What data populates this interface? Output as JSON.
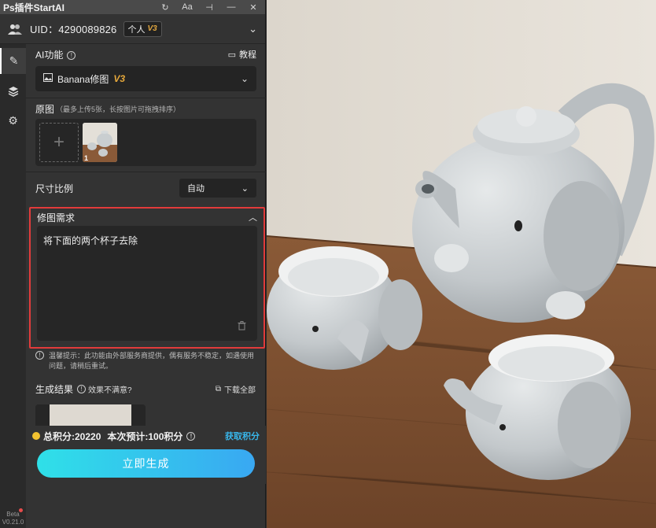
{
  "app": {
    "title": "Ps插件StartAI"
  },
  "window_controls": [
    {
      "name": "refresh-icon",
      "glyph": "↻"
    },
    {
      "name": "font-size-icon",
      "glyph": "Aa"
    },
    {
      "name": "pin-icon",
      "glyph": "⊣"
    },
    {
      "name": "minimize-icon",
      "glyph": "—"
    },
    {
      "name": "close-icon",
      "glyph": "✕"
    }
  ],
  "account": {
    "uid": "UID：4290089826",
    "plan": "个人",
    "level": "V3"
  },
  "rail": {
    "items": [
      "edit-icon",
      "layers-icon",
      "settings-icon"
    ],
    "version_top": "Beta",
    "version": "V0.21.0"
  },
  "ai_function": {
    "label": "AI功能",
    "tutorial": "教程",
    "selected": "Banana修图",
    "selected_badge": "V3"
  },
  "source_images": {
    "label": "原图",
    "hint": "（最多上传5张，长按图片可拖拽排序）",
    "add": "+",
    "thumb_index": "1"
  },
  "ratio": {
    "label": "尺寸比例",
    "value": "自动"
  },
  "request": {
    "label": "修图需求",
    "text": "将下面的两个杯子去除"
  },
  "notice": "温馨提示：此功能由外部服务商提供，偶有服务不稳定，如遇使用问题，请稍后重试。",
  "result": {
    "label": "生成结果",
    "feedback": "效果不满意?",
    "download_all": "下载全部"
  },
  "footer": {
    "points": "总积分:20220",
    "estimate": "本次预计:100积分",
    "get_points": "获取积分",
    "generate": "立即生成"
  },
  "colors": {
    "accent_red": "#e23b3b",
    "accent_gold": "#e6a83b",
    "link_blue": "#38b6ea",
    "button_gradient_start": "#2fe0e8",
    "button_gradient_end": "#39a8f2"
  }
}
